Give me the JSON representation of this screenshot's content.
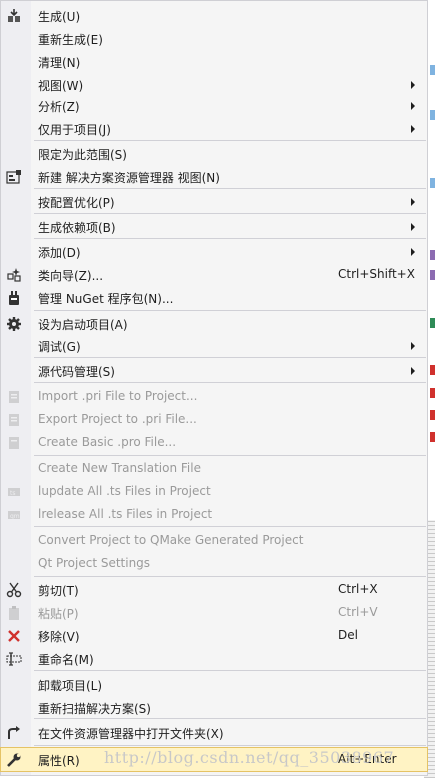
{
  "menu": {
    "items": [
      {
        "label": "生成(U)",
        "shortcut": "",
        "icon": "build-icon",
        "submenu": false,
        "disabled": false
      },
      {
        "label": "重新生成(E)",
        "shortcut": "",
        "icon": "",
        "submenu": false,
        "disabled": false
      },
      {
        "label": "清理(N)",
        "shortcut": "",
        "icon": "",
        "submenu": false,
        "disabled": false
      },
      {
        "label": "视图(W)",
        "shortcut": "",
        "icon": "",
        "submenu": true,
        "disabled": false
      },
      {
        "label": "分析(Z)",
        "shortcut": "",
        "icon": "",
        "submenu": true,
        "disabled": false
      },
      {
        "label": "仅用于项目(J)",
        "shortcut": "",
        "icon": "",
        "submenu": true,
        "disabled": false
      },
      {
        "label": "限定为此范围(S)",
        "shortcut": "",
        "icon": "",
        "submenu": false,
        "disabled": false
      },
      {
        "label": "新建 解决方案资源管理器 视图(N)",
        "shortcut": "",
        "icon": "new-view-icon",
        "submenu": false,
        "disabled": false
      },
      {
        "label": "按配置优化(P)",
        "shortcut": "",
        "icon": "",
        "submenu": true,
        "disabled": false
      },
      {
        "label": "生成依赖项(B)",
        "shortcut": "",
        "icon": "",
        "submenu": true,
        "disabled": false
      },
      {
        "label": "添加(D)",
        "shortcut": "",
        "icon": "",
        "submenu": true,
        "disabled": false
      },
      {
        "label": "类向导(Z)...",
        "shortcut": "Ctrl+Shift+X",
        "icon": "class-wizard-icon",
        "submenu": false,
        "disabled": false
      },
      {
        "label": "管理 NuGet 程序包(N)...",
        "shortcut": "",
        "icon": "nuget-icon",
        "submenu": false,
        "disabled": false
      },
      {
        "label": "设为启动项目(A)",
        "shortcut": "",
        "icon": "gear-icon",
        "submenu": false,
        "disabled": false
      },
      {
        "label": "调试(G)",
        "shortcut": "",
        "icon": "",
        "submenu": true,
        "disabled": false
      },
      {
        "label": "源代码管理(S)",
        "shortcut": "",
        "icon": "",
        "submenu": true,
        "disabled": false
      },
      {
        "label": "Import .pri File to Project...",
        "shortcut": "",
        "icon": "import-icon",
        "submenu": false,
        "disabled": true
      },
      {
        "label": "Export Project to .pri File...",
        "shortcut": "",
        "icon": "export-icon",
        "submenu": false,
        "disabled": true
      },
      {
        "label": "Create Basic .pro File...",
        "shortcut": "",
        "icon": "pro-file-icon",
        "submenu": false,
        "disabled": true
      },
      {
        "label": "Create New Translation File",
        "shortcut": "",
        "icon": "",
        "submenu": false,
        "disabled": true
      },
      {
        "label": "lupdate All .ts Files in Project",
        "shortcut": "",
        "icon": "lupdate-icon",
        "submenu": false,
        "disabled": true
      },
      {
        "label": "lrelease All .ts Files in Project",
        "shortcut": "",
        "icon": "lrelease-icon",
        "submenu": false,
        "disabled": true
      },
      {
        "label": "Convert Project to QMake Generated Project",
        "shortcut": "",
        "icon": "",
        "submenu": false,
        "disabled": true
      },
      {
        "label": "Qt Project Settings",
        "shortcut": "",
        "icon": "",
        "submenu": false,
        "disabled": true
      },
      {
        "label": "剪切(T)",
        "shortcut": "Ctrl+X",
        "icon": "scissors-icon",
        "submenu": false,
        "disabled": false
      },
      {
        "label": "粘贴(P)",
        "shortcut": "Ctrl+V",
        "icon": "paste-icon",
        "submenu": false,
        "disabled": true
      },
      {
        "label": "移除(V)",
        "shortcut": "Del",
        "icon": "remove-icon",
        "submenu": false,
        "disabled": false
      },
      {
        "label": "重命名(M)",
        "shortcut": "",
        "icon": "rename-icon",
        "submenu": false,
        "disabled": false
      },
      {
        "label": "卸载项目(L)",
        "shortcut": "",
        "icon": "",
        "submenu": false,
        "disabled": false
      },
      {
        "label": "重新扫描解决方案(S)",
        "shortcut": "",
        "icon": "",
        "submenu": false,
        "disabled": false
      },
      {
        "label": "在文件资源管理器中打开文件夹(X)",
        "shortcut": "",
        "icon": "open-folder-icon",
        "submenu": false,
        "disabled": false
      },
      {
        "label": "属性(R)",
        "shortcut": "Alt+Enter",
        "icon": "wrench-icon",
        "submenu": false,
        "disabled": false,
        "highlighted": true
      }
    ]
  },
  "watermark": "http://blog.csdn.net/qq_35038967",
  "colors": {
    "menu_bg": "#f5f5f5",
    "icon_column": "#eeeef2",
    "highlight_bg": "#fff3c4",
    "highlight_border": "#e5c365",
    "disabled_text": "#9a9a9a",
    "remove_icon": "#d0312d"
  }
}
